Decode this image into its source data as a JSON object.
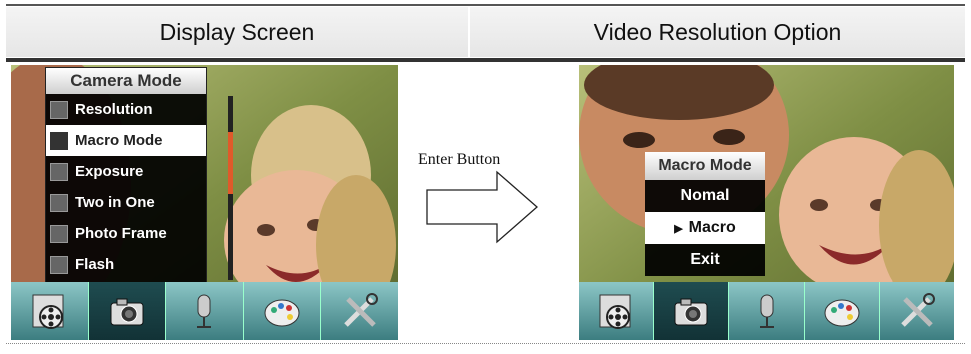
{
  "headers": {
    "left": "Display Screen",
    "right": "Video Resolution Option"
  },
  "middle": {
    "label": "Enter Button"
  },
  "camera_menu": {
    "title": "Camera Mode",
    "items": [
      {
        "label": "Resolution",
        "icon": "resolution-icon"
      },
      {
        "label": "Macro Mode",
        "icon": "macro-icon",
        "selected": true
      },
      {
        "label": "Exposure",
        "icon": "exposure-icon"
      },
      {
        "label": "Two in One",
        "icon": "two-in-one-icon"
      },
      {
        "label": "Photo Frame",
        "icon": "photo-frame-icon"
      },
      {
        "label": "Flash",
        "icon": "flash-icon"
      }
    ]
  },
  "macro_menu": {
    "title": "Macro Mode",
    "items": [
      {
        "label": "Nomal"
      },
      {
        "label": "Macro",
        "selected": true
      },
      {
        "label": "Exit"
      }
    ]
  },
  "toolbar": {
    "items": [
      "film-reel-icon",
      "camera-icon",
      "microphone-icon",
      "palette-icon",
      "tools-icon"
    ],
    "active_index": 1
  },
  "colors": {
    "menu_bg": "#000000",
    "scroll_thumb": "#e05a2a",
    "toolbar": "#3c7d80"
  }
}
